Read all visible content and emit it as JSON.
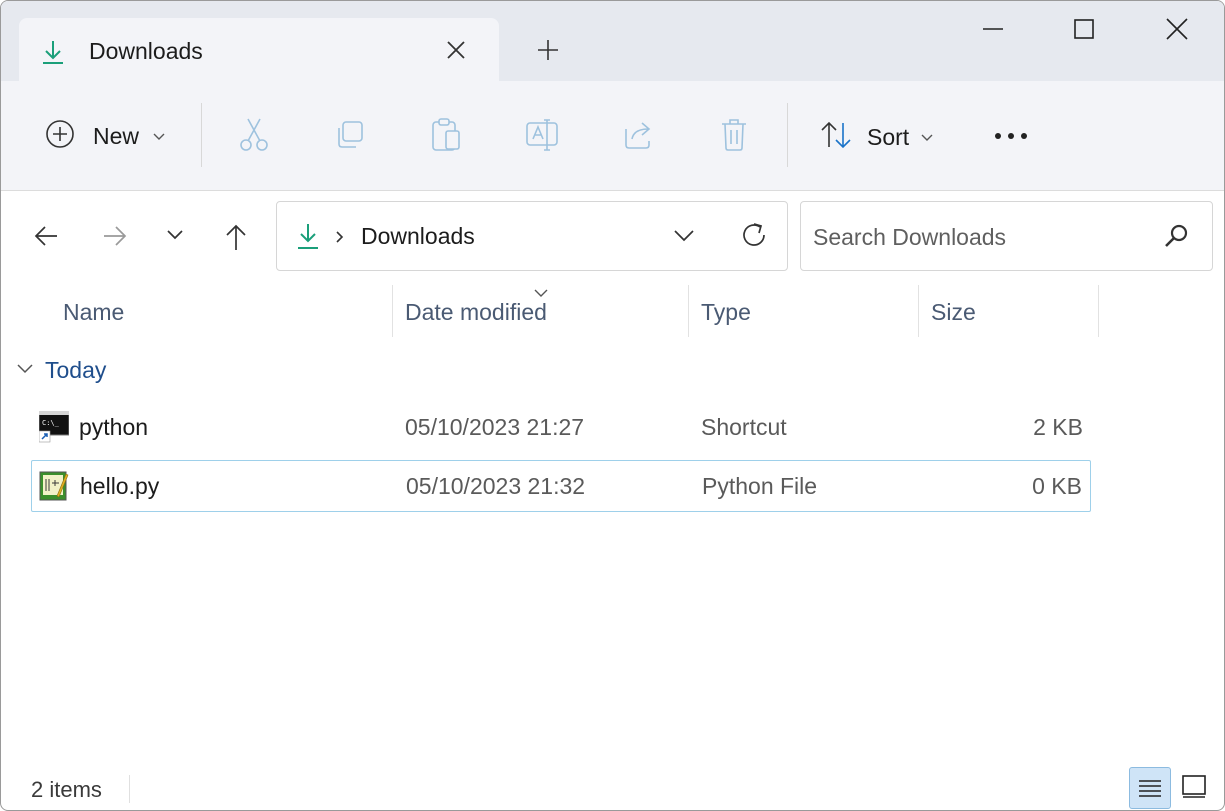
{
  "window": {
    "tab_title": "Downloads",
    "accent": "#1a9f7a"
  },
  "toolbar": {
    "new_label": "New",
    "sort_label": "Sort",
    "icons": [
      "cut-icon",
      "copy-icon",
      "paste-icon",
      "rename-icon",
      "share-icon",
      "delete-icon"
    ]
  },
  "navigation": {
    "breadcrumb": "Downloads",
    "search_placeholder": "Search Downloads"
  },
  "columns": {
    "name": "Name",
    "date": "Date modified",
    "type": "Type",
    "size": "Size"
  },
  "group": {
    "label": "Today"
  },
  "files": [
    {
      "name": "python",
      "date": "05/10/2023 21:27",
      "type": "Shortcut",
      "size": "2 KB",
      "icon": "console-shortcut-icon"
    },
    {
      "name": "hello.py",
      "date": "05/10/2023 21:32",
      "type": "Python File",
      "size": "0 KB",
      "icon": "python-file-icon"
    }
  ],
  "status": {
    "item_count": "2 items"
  }
}
